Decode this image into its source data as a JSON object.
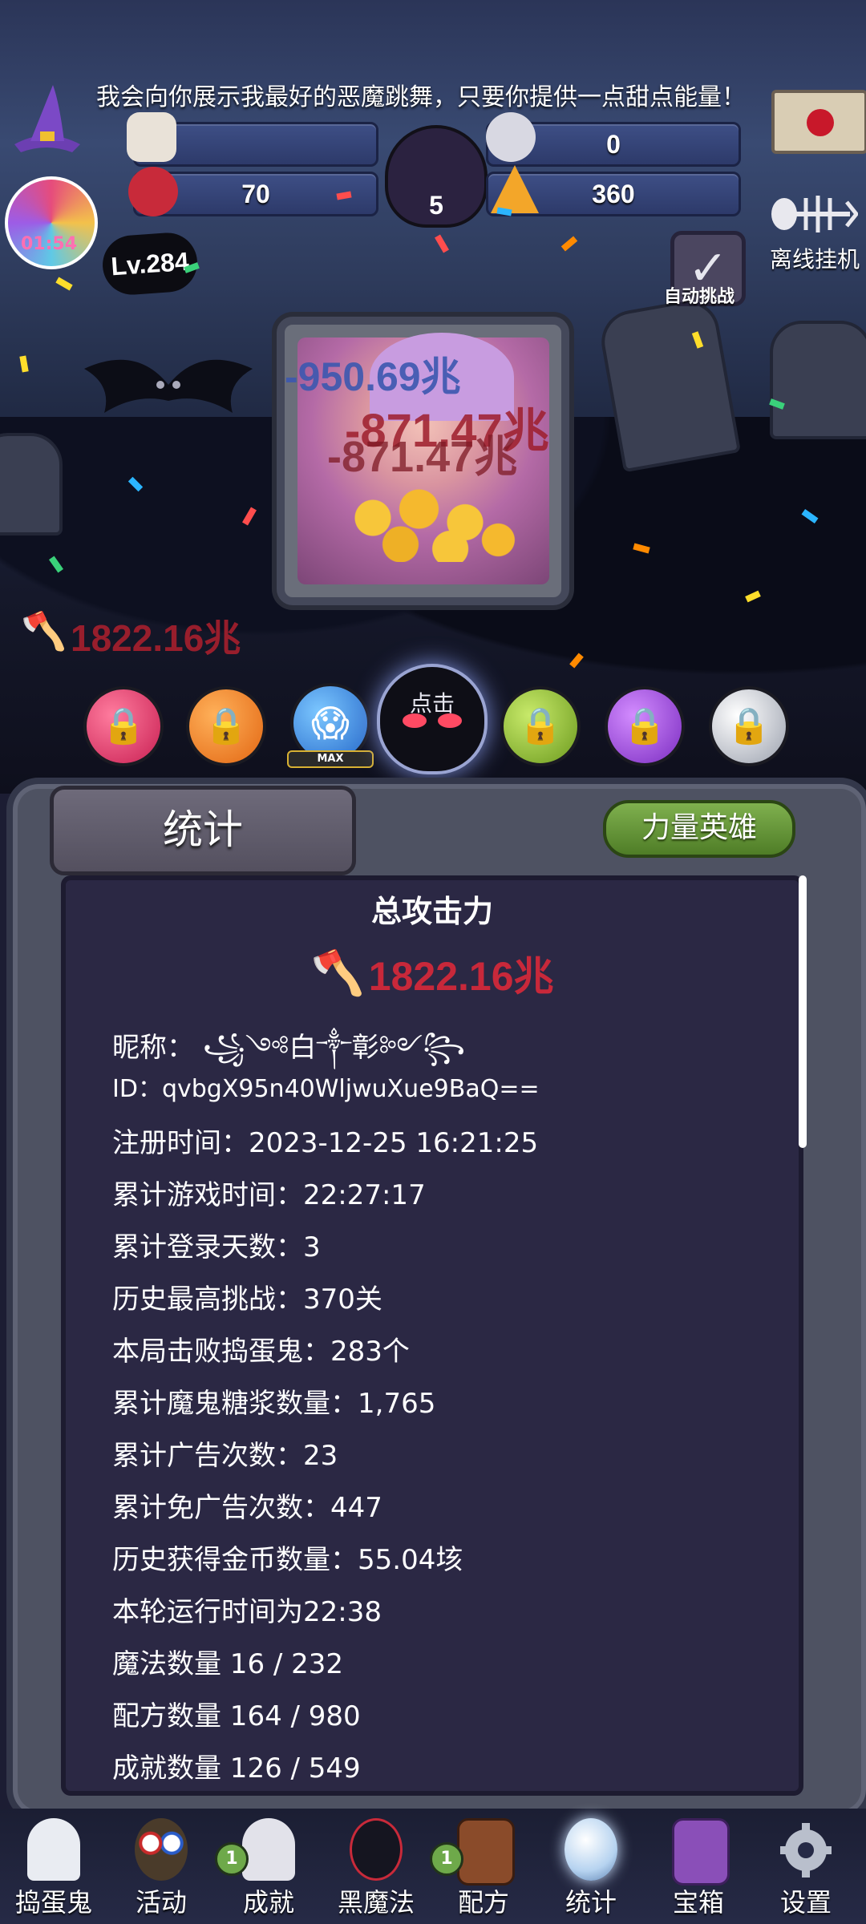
{
  "banner": {
    "speech": "我会向你展示我最好的恶魔跳舞，只要你提供一点甜点能量！"
  },
  "resources": {
    "top_right_value": "0",
    "mid_left_value": "70",
    "cauldron_value": "5",
    "mid_right_value": "360"
  },
  "player": {
    "level": "Lv.284",
    "candy_timer": "01:54"
  },
  "auto_challenge": {
    "label": "自动挑战"
  },
  "offline": {
    "label": "离线挂机"
  },
  "damage_popups": [
    "-950.69兆",
    "-871.47兆",
    "-871.47兆"
  ],
  "attack_power_small": "1822.16兆",
  "skill_orbs": {
    "max_label": "MAX",
    "devil_label": "点击"
  },
  "panel": {
    "tab_title": "统计",
    "hero_button": "力量英雄",
    "total_title": "总攻击力",
    "total_value": "1822.16兆",
    "stats": [
      "昵称：  ꧁༺白༒彰༻꧂",
      "ID：qvbgX95n40WljwuXue9BaQ==",
      "注册时间：2023-12-25 16:21:25",
      "累计游戏时间：22:27:17",
      "累计登录天数：3",
      "历史最高挑战：370关",
      "本局击败捣蛋鬼：283个",
      "累计魔鬼糖浆数量：1,765",
      "累计广告次数：23",
      "累计免广告次数：447",
      "历史获得金币数量：55.04垓",
      "本轮运行时间为22:38",
      "魔法数量 16 / 232",
      "配方数量 164 / 980",
      "成就数量 126 / 549"
    ]
  },
  "nav": {
    "items": [
      "捣蛋鬼",
      "活动",
      "成就",
      "黑魔法",
      "配方",
      "统计",
      "宝箱",
      "设置"
    ],
    "badges": {
      "achievements": "1",
      "recipes": "1"
    }
  },
  "colors": {
    "accent_red": "#c8283a",
    "panel_bg": "#2b2844",
    "hero_green": "#6ea94a"
  }
}
